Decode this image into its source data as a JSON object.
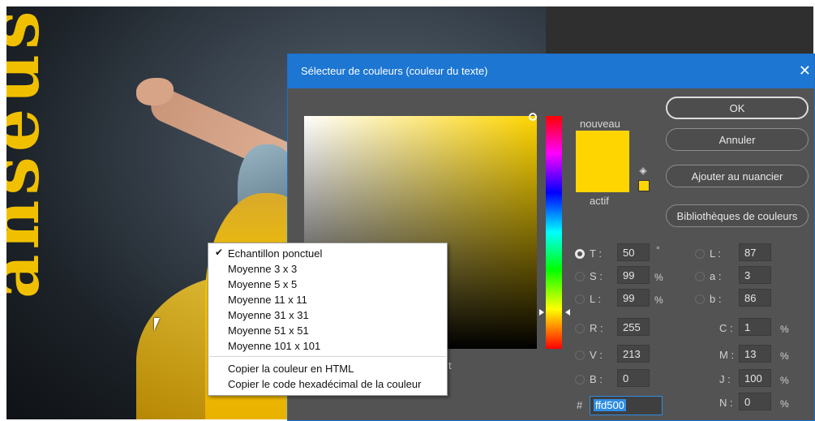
{
  "background": {
    "vertical_text": "anseuse",
    "accent_color": "#f0c000"
  },
  "dialog": {
    "title": "Sélecteur de couleurs (couleur du texte)",
    "close_label": "✕",
    "labels": {
      "new": "nouveau",
      "current": "actif"
    },
    "buttons": {
      "ok": "OK",
      "cancel": "Annuler",
      "add_swatch": "Ajouter au nuancier",
      "libraries": "Bibliothèques de couleurs"
    },
    "fields": {
      "H": {
        "label": "T :",
        "value": "50",
        "unit": "°"
      },
      "S": {
        "label": "S :",
        "value": "99",
        "unit": "%"
      },
      "B": {
        "label": "L :",
        "value": "99",
        "unit": "%"
      },
      "R": {
        "label": "R :",
        "value": "255"
      },
      "G": {
        "label": "V :",
        "value": "213"
      },
      "Bl": {
        "label": "B :",
        "value": "0"
      },
      "Lab_L": {
        "label": "L :",
        "value": "87"
      },
      "Lab_a": {
        "label": "a :",
        "value": "3"
      },
      "Lab_b": {
        "label": "b :",
        "value": "86"
      },
      "C": {
        "label": "C :",
        "value": "1",
        "unit": "%"
      },
      "M": {
        "label": "M :",
        "value": "13",
        "unit": "%"
      },
      "J": {
        "label": "J :",
        "value": "100",
        "unit": "%"
      },
      "N": {
        "label": "N :",
        "value": "0",
        "unit": "%"
      }
    },
    "hex": {
      "prefix": "#",
      "value": "ffd500"
    },
    "new_color": "#ffd500",
    "current_color": "#ffd500",
    "partial_label_t": "t"
  },
  "context_menu": {
    "items": [
      "Echantillon ponctuel",
      "Moyenne 3 x 3",
      "Moyenne 5 x 5",
      "Moyenne 11 x 11",
      "Moyenne 31 x 31",
      "Moyenne 51 x 51",
      "Moyenne 101 x 101"
    ],
    "copy_items": [
      "Copier la couleur en HTML",
      "Copier le code hexadécimal de la couleur"
    ],
    "checked_mark": "✔"
  }
}
